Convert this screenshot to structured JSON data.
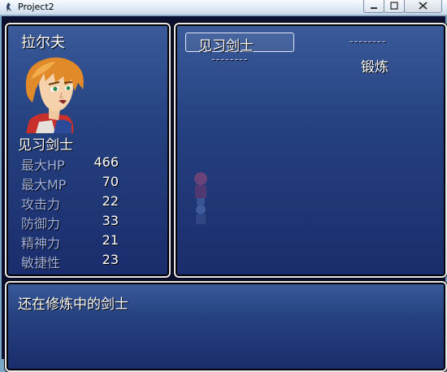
{
  "window": {
    "title": "Project2"
  },
  "actor": {
    "name": "拉尔夫",
    "class": "见习剑士",
    "stats": [
      {
        "label": "最大HP",
        "value": "466"
      },
      {
        "label": "最大MP",
        "value": "70"
      },
      {
        "label": "攻击力",
        "value": "22"
      },
      {
        "label": "防御力",
        "value": "33"
      },
      {
        "label": "精神力",
        "value": "21"
      },
      {
        "label": "敏捷性",
        "value": "23"
      }
    ]
  },
  "skill_panel": {
    "selected_class": "见习剑士",
    "left_dashes": "--------",
    "right_dashes": "--------",
    "right_label": "锻炼"
  },
  "help": {
    "text": "还在修炼中的剑士"
  },
  "colors": {
    "window_top": "#3a5a9a",
    "window_bottom": "#1a2c6c",
    "stat_label": "#9fb2e6"
  }
}
